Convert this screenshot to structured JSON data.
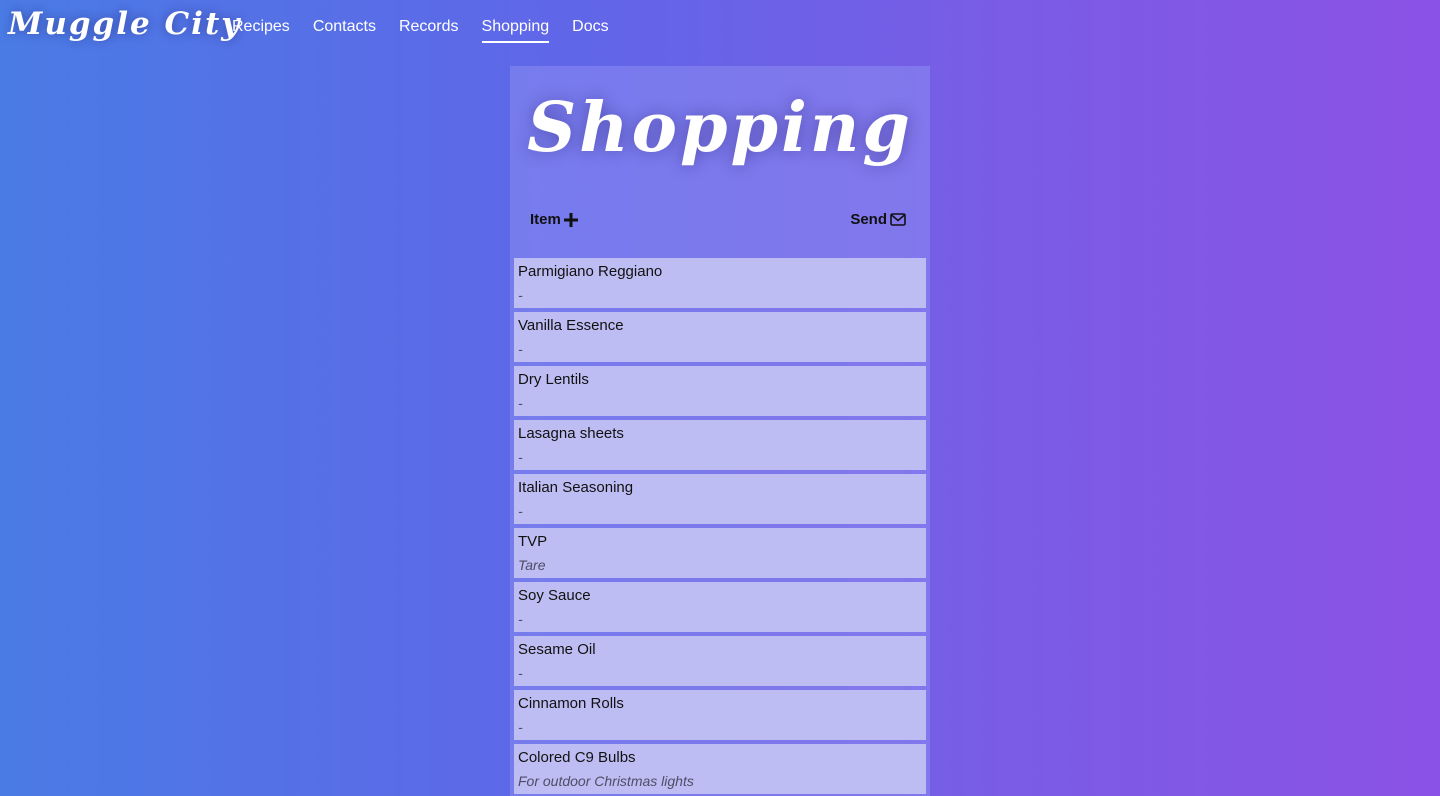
{
  "brand": "Muggle City",
  "nav": {
    "items": [
      {
        "label": "Recipes",
        "active": false
      },
      {
        "label": "Contacts",
        "active": false
      },
      {
        "label": "Records",
        "active": false
      },
      {
        "label": "Shopping",
        "active": true
      },
      {
        "label": "Docs",
        "active": false
      }
    ]
  },
  "page": {
    "title": "Shopping",
    "add_label": "Item",
    "add_icon": "plus-icon",
    "send_label": "Send",
    "send_icon": "envelope-icon"
  },
  "items": [
    {
      "name": "Parmigiano Reggiano",
      "note": "-"
    },
    {
      "name": "Vanilla Essence",
      "note": "-"
    },
    {
      "name": "Dry Lentils",
      "note": "-"
    },
    {
      "name": "Lasagna sheets",
      "note": "-"
    },
    {
      "name": "Italian Seasoning",
      "note": "-"
    },
    {
      "name": "TVP",
      "note": "Tare"
    },
    {
      "name": "Soy Sauce",
      "note": "-"
    },
    {
      "name": "Sesame Oil",
      "note": "-"
    },
    {
      "name": "Cinnamon Rolls",
      "note": "-"
    },
    {
      "name": "Colored C9 Bulbs",
      "note": "For outdoor Christmas lights"
    }
  ],
  "colors": {
    "gradient_start": "#4a7be5",
    "gradient_end": "#8b52e6",
    "item_background": "#bebdf3",
    "text": "#111111"
  }
}
